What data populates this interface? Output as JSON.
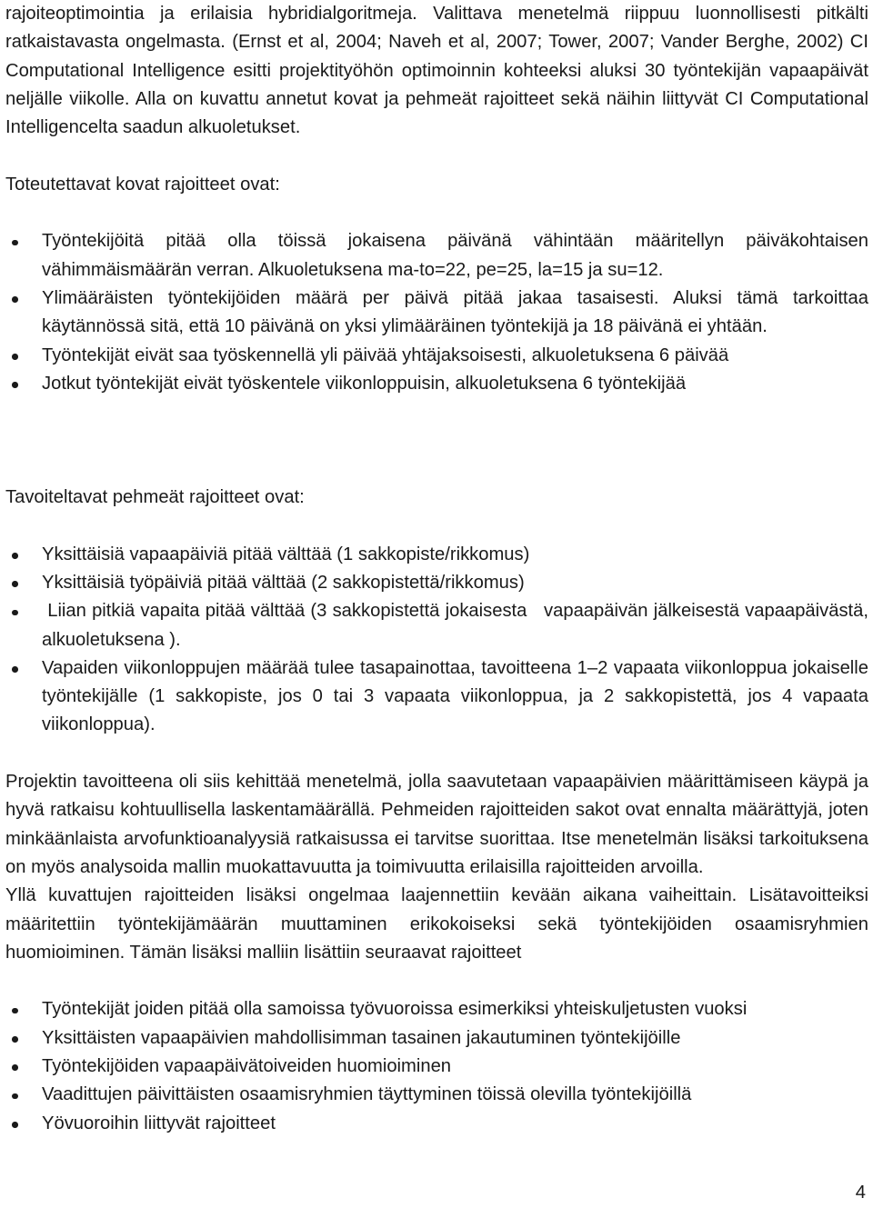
{
  "document": {
    "language": "fi",
    "page_number": "4",
    "intro_paragraph": {
      "line_1": "rajoiteoptimointia ja erilaisia hybridialgoritmeja. Valittava menetelmä riippuu luonnollisesti pitkälti",
      "line_2": "ratkaistavasta ongelmasta. (Ernst et al, 2004; Naveh et al, 2007; Tower, 2007; Vander Berghe, 2002)",
      "line_3": "CI Computational Intelligence esitti projektityöhön optimoinnin kohteeksi aluksi 30 työntekijän",
      "line_4": "vapaapäivät neljälle viikolle. Alla on kuvattu annetut kovat ja pehmeät rajoitteet sekä näihin liittyvät CI",
      "line_5": "Computational Intelligencelta saadun alkuoletukset.",
      "full_text": "rajoiteoptimointia ja erilaisia hybridialgoritmeja. Valittava menetelmä riippuu luonnollisesti pitkälti ratkaistavasta ongelmasta. (Ernst et al, 2004; Naveh et al, 2007; Tower, 2007; Vander Berghe, 2002) CI Computational Intelligence esitti projektityöhön optimoinnin kohteeksi aluksi 30 työntekijän vapaapäivät neljälle viikolle. Alla on kuvattu annetut kovat ja pehmeät rajoitteet sekä näihin liittyvät CI Computational Intelligencelta saadun alkuoletukset."
    },
    "hard_constraints": {
      "heading": "Toteutettavat kovat rajoitteet ovat:",
      "items": [
        "Työntekijöitä pitää olla töissä jokaisena päivänä vähintään määritellyn päiväkohtaisen vähimmäismäärän verran. Alkuoletuksena ma-to=22, pe=25, la=15 ja su=12.",
        "Ylimääräisten työntekijöiden määrä per päivä pitää jakaa tasaisesti. Aluksi tämä tarkoittaa käytännössä sitä, että 10 päivänä on yksi ylimääräinen työntekijä ja 18 päivänä ei yhtään.",
        "Työntekijät eivät saa työskennellä yli päivää yhtäjaksoisesti, alkuoletuksena 6 päivää",
        "Jotkut työntekijät eivät työskentele viikonloppuisin, alkuoletuksena 6 työntekijää"
      ]
    },
    "soft_constraints": {
      "heading": "Tavoiteltavat pehmeät rajoitteet ovat:",
      "items": [
        "Yksittäisiä vapaapäiviä pitää välttää (1 sakkopiste/rikkomus)",
        "Yksittäisiä työpäiviä pitää välttää (2 sakkopistettä/rikkomus)",
        " Liian pitkiä vapaita pitää välttää (3 sakkopistettä jokaisesta   vapaapäivän jälkeisestä vapaapäivästä, alkuoletuksena ).",
        "Vapaiden viikonloppujen määrää tulee tasapainottaa, tavoitteena 1–2 vapaata viikonloppua jokaiselle työntekijälle (1 sakkopiste, jos 0 tai 3 vapaata viikonloppua, ja 2 sakkopistettä, jos 4 vapaata viikonloppua)."
      ]
    },
    "goal_paragraph": {
      "text": "Projektin tavoitteena oli siis kehittää menetelmä, jolla saavutetaan vapaapäivien määrittämiseen käypä ja hyvä ratkaisu kohtuullisella laskentamäärällä. Pehmeiden rajoitteiden sakot ovat ennalta määrättyjä, joten minkäänlaista arvofunktioanalyysiä ratkaisussa ei tarvitse suorittaa. Itse menetelmän lisäksi tarkoituksena on myös analysoida mallin muokattavuutta ja toimivuutta erilaisilla rajoitteiden arvoilla."
    },
    "extension_paragraph": {
      "text": "Yllä kuvattujen rajoitteiden lisäksi ongelmaa laajennettiin kevään aikana vaiheittain. Lisätavoitteiksi määritettiin työntekijämäärän muuttaminen erikokoiseksi sekä työntekijöiden osaamisryhmien huomioiminen. Tämän lisäksi malliin lisättiin seuraavat rajoitteet"
    },
    "additional_constraints": {
      "items": [
        "Työntekijät joiden pitää olla samoissa työvuoroissa esimerkiksi yhteiskuljetusten vuoksi",
        "Yksittäisten vapaapäivien mahdollisimman tasainen jakautuminen työntekijöille",
        "Työntekijöiden vapaapäivätoiveiden huomioiminen",
        "Vaadittujen päivittäisten osaamisryhmien täyttyminen töissä olevilla työntekijöillä",
        "Yövuoroihin liittyvät rajoitteet"
      ]
    }
  }
}
